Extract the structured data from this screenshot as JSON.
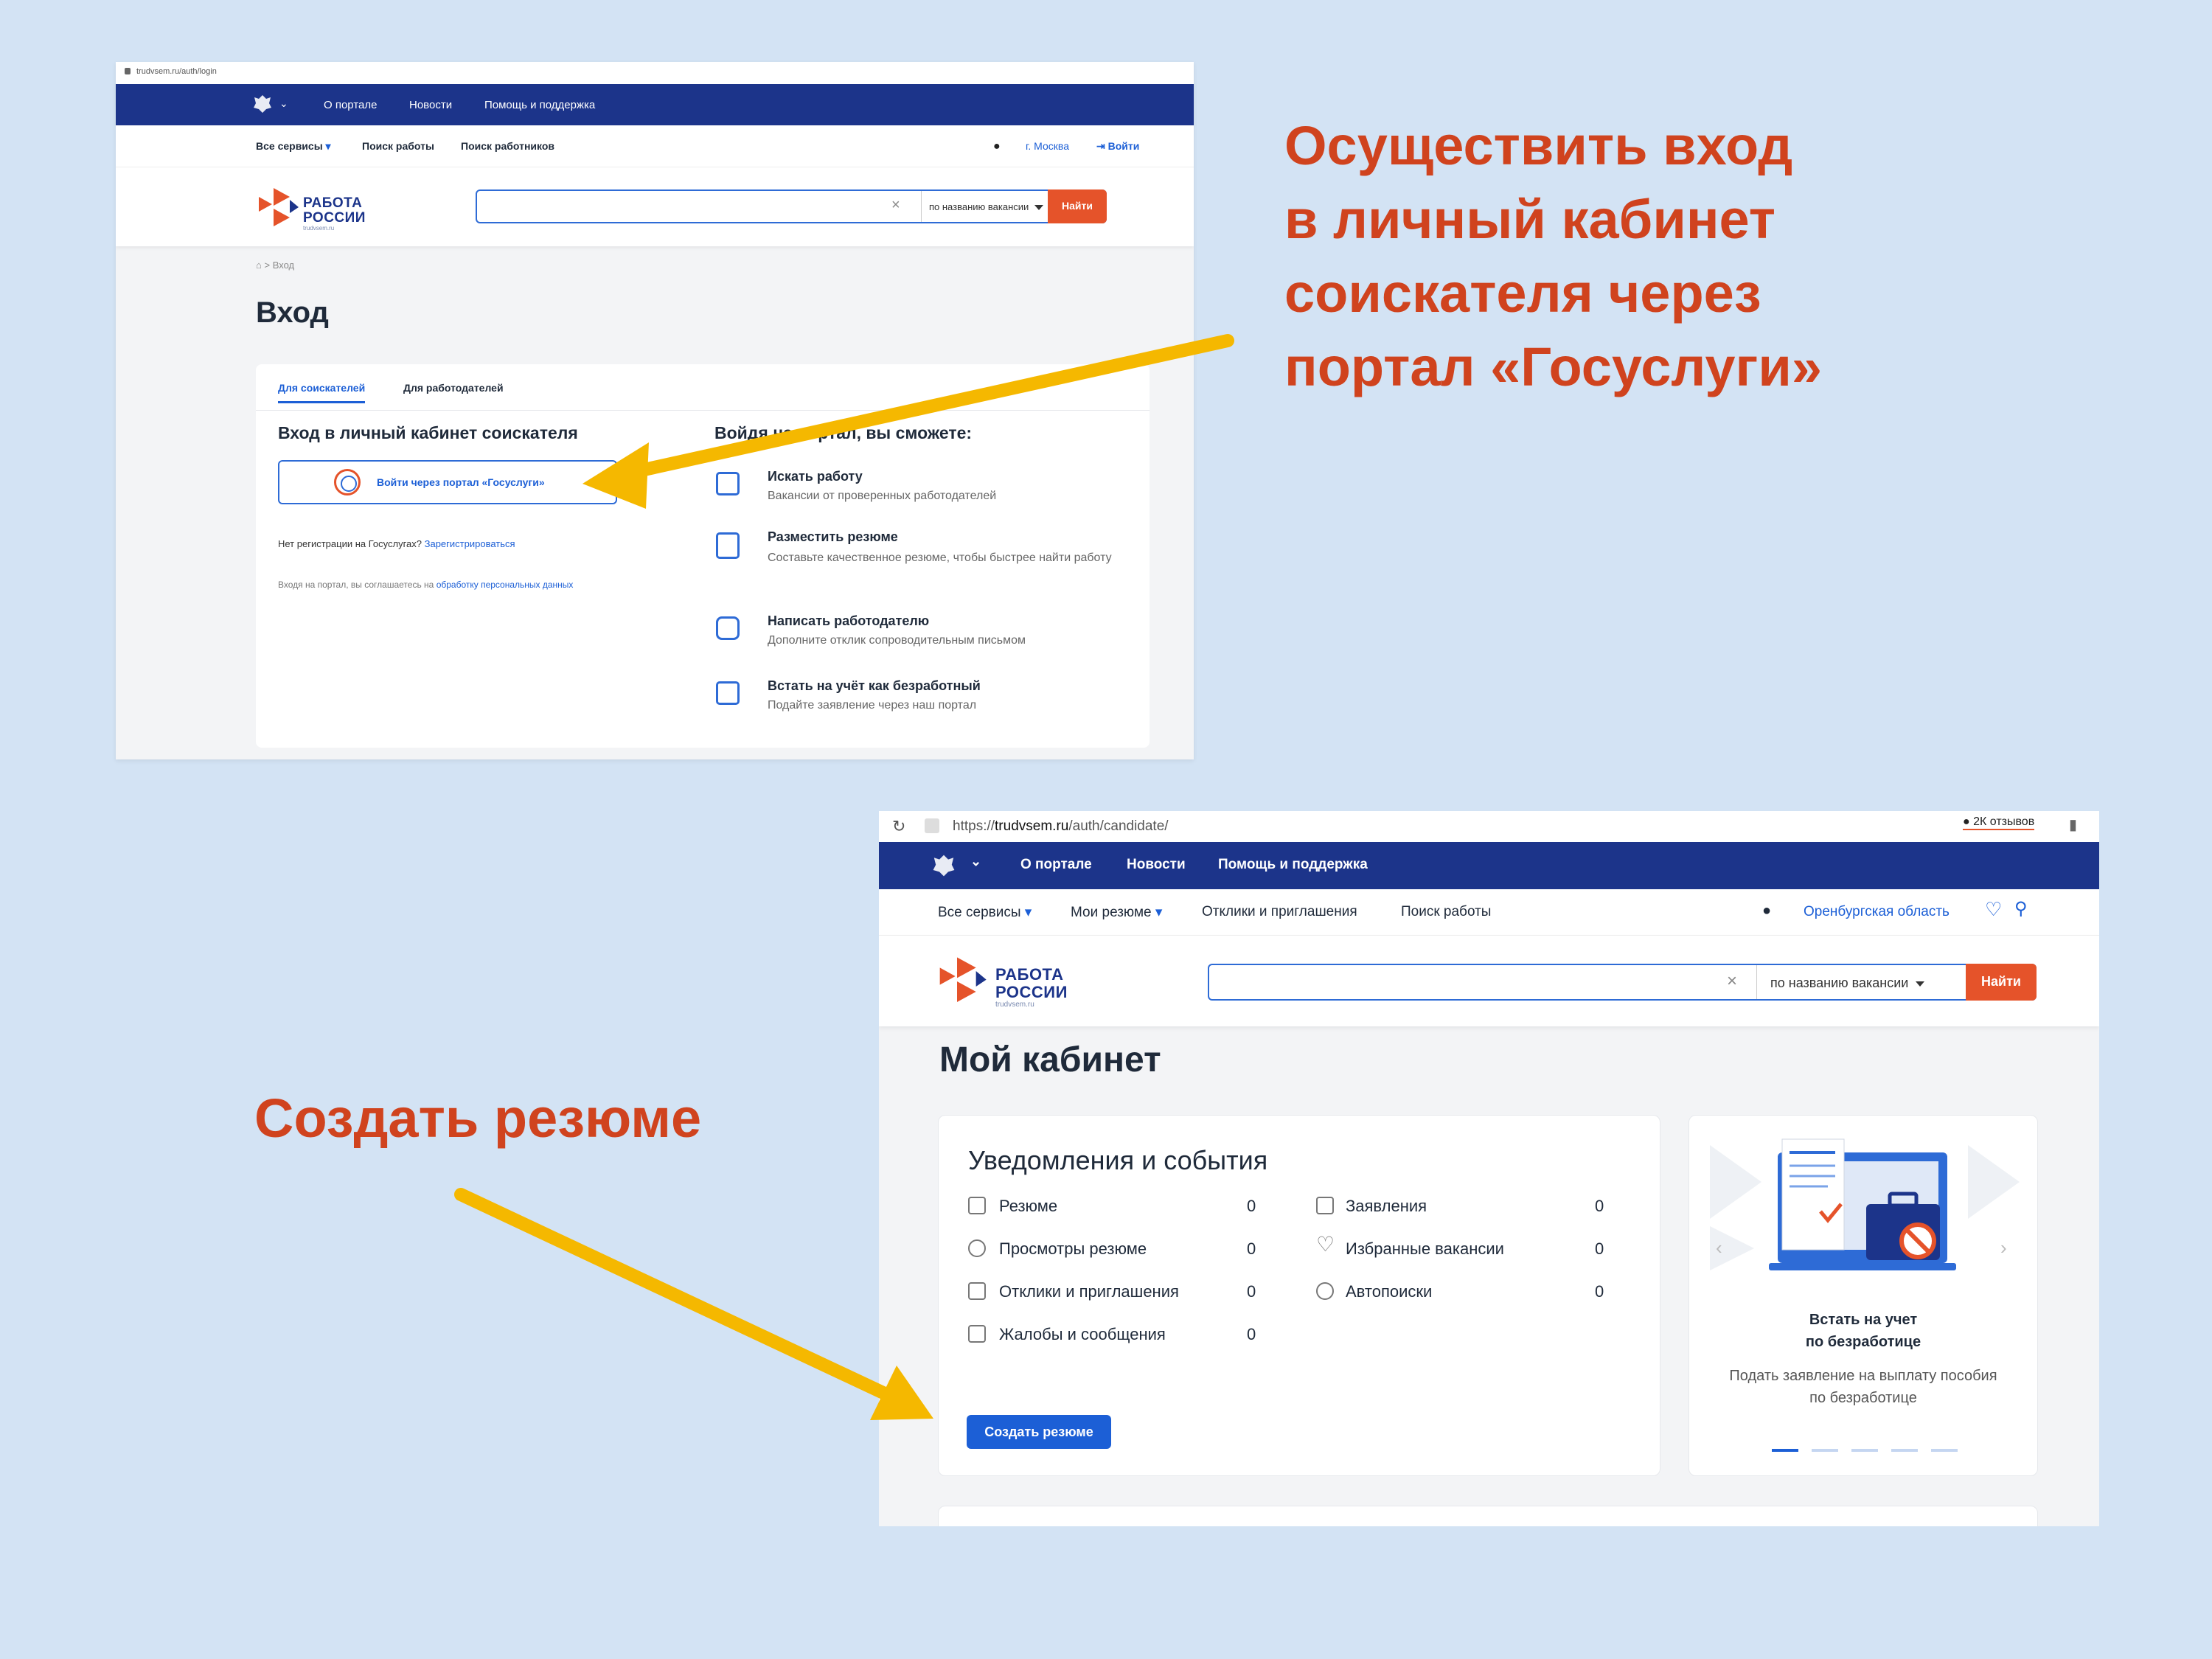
{
  "callouts": {
    "login_lines": [
      "Осуществить вход",
      "в личный кабинет",
      "соискателя через",
      "портал «Госуслуги»"
    ],
    "create_resume": "Создать резюме",
    "arrow_color": "#f5b800",
    "text_color": "#d0431e"
  },
  "shot1": {
    "url": "trudvsem.ru/auth/login",
    "topnav": [
      "О портале",
      "Новости",
      "Помощь и поддержка"
    ],
    "subnav": {
      "services": "Все сервисы",
      "search_jobs": "Поиск работы",
      "search_workers": "Поиск работников",
      "city": "г. Москва",
      "login": "Войти"
    },
    "logo": {
      "line1": "РАБОТА",
      "line2": "РОССИИ",
      "domain": "trudvsem.ru"
    },
    "search": {
      "select": "по названию вакансии",
      "button": "Найти"
    },
    "breadcrumb": {
      "current": "Вход"
    },
    "title": "Вход",
    "tabs": [
      "Для соискателей",
      "Для работодателей"
    ],
    "left": {
      "heading": "Вход в личный кабинет соискателя",
      "gosuslugi_button": "Войти через портал «Госуслуги»",
      "no_reg": "Нет регистрации на Госуслугах?",
      "register_link": "Зарегистрироваться",
      "consent": "Входя на портал, вы соглашаетесь на",
      "consent_link": "обработку персональных данных"
    },
    "right": {
      "heading": "Войдя на портал, вы сможете:",
      "features": [
        {
          "title": "Искать работу",
          "desc": "Вакансии от проверенных работодателей",
          "icon": "briefcase-icon"
        },
        {
          "title": "Разместить резюме",
          "desc": "Составьте качественное резюме, чтобы быстрее найти работу",
          "icon": "resume-icon"
        },
        {
          "title": "Написать работодателю",
          "desc": "Дополните отклик сопроводительным письмом",
          "icon": "chat-icon"
        },
        {
          "title": "Встать на учёт как безработный",
          "desc": "Подайте заявление через наш портал",
          "icon": "unemployed-icon"
        }
      ]
    }
  },
  "shot2": {
    "url_prefix": "https://",
    "url_domain": "trudvsem.ru",
    "url_path": "/auth/candidate/",
    "reviews": "2К отзывов",
    "topnav": [
      "О портале",
      "Новости",
      "Помощь и поддержка"
    ],
    "subnav": {
      "services": "Все сервисы",
      "my_resumes": "Мои резюме",
      "responses": "Отклики и приглашения",
      "search_jobs": "Поиск работы",
      "region": "Оренбургская область"
    },
    "logo": {
      "line1": "РАБОТА",
      "line2": "РОССИИ",
      "domain": "trudvsem.ru"
    },
    "search": {
      "select": "по названию вакансии",
      "button": "Найти"
    },
    "title": "Мой кабинет",
    "notifications": {
      "heading": "Уведомления и события",
      "left": [
        {
          "label": "Резюме",
          "value": "0"
        },
        {
          "label": "Просмотры резюме",
          "value": "0"
        },
        {
          "label": "Отклики и приглашения",
          "value": "0"
        },
        {
          "label": "Жалобы и сообщения",
          "value": "0"
        }
      ],
      "right": [
        {
          "label": "Заявления",
          "value": "0"
        },
        {
          "label": "Избранные вакансии",
          "value": "0"
        },
        {
          "label": "Автопоиски",
          "value": "0"
        }
      ],
      "create_button": "Создать резюме"
    },
    "promo": {
      "title_line1": "Встать на учет",
      "title_line2": "по безработице",
      "desc_line1": "Подать заявление на выплату пособия",
      "desc_line2": "по безработице"
    }
  }
}
